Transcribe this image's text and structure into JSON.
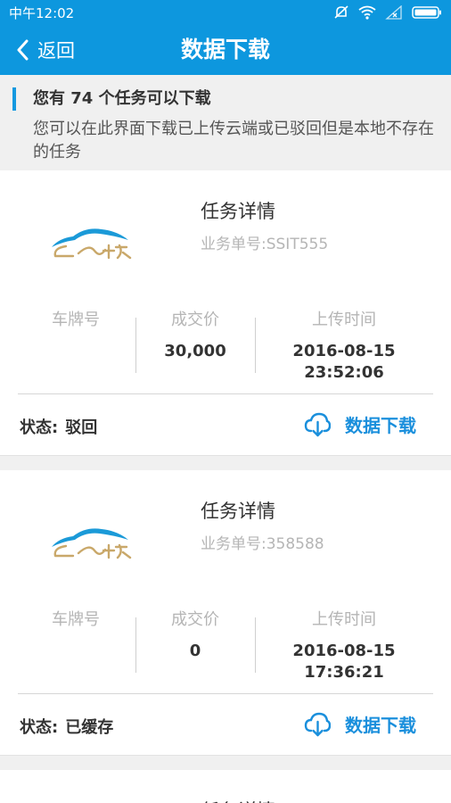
{
  "status_bar": {
    "time": "中午12:02"
  },
  "navbar": {
    "back_label": "返回",
    "title": "数据下载"
  },
  "notice": {
    "headline": "您有 74 个任务可以下载",
    "description": "您可以在此界面下载已上传云端或已驳回但是本地不存在的任务"
  },
  "labels": {
    "card_title": "任务详情",
    "plate": "车牌号",
    "price": "成交价",
    "upload_time": "上传时间",
    "status_prefix": "状态:",
    "download": "数据下载"
  },
  "tasks": [
    {
      "order_no": "业务单号:SSIT555",
      "plate": "",
      "price": "30,000",
      "upload_date": "2016-08-15",
      "upload_clock": "23:52:06",
      "status": "驳回"
    },
    {
      "order_no": "业务单号:358588",
      "plate": "",
      "price": "0",
      "upload_date": "2016-08-15",
      "upload_clock": "17:36:21",
      "status": "已缓存"
    },
    {
      "order_no": "",
      "plate": "",
      "price": "",
      "upload_date": "",
      "upload_clock": "",
      "status": ""
    }
  ],
  "colors": {
    "primary": "#0d97de",
    "accent": "#1a8fdc",
    "muted": "#b5b5b5"
  },
  "icons": [
    "back-chevron-icon",
    "mute-icon",
    "wifi-icon",
    "signal-icon",
    "battery-icon",
    "cloud-download-icon",
    "company-logo"
  ]
}
